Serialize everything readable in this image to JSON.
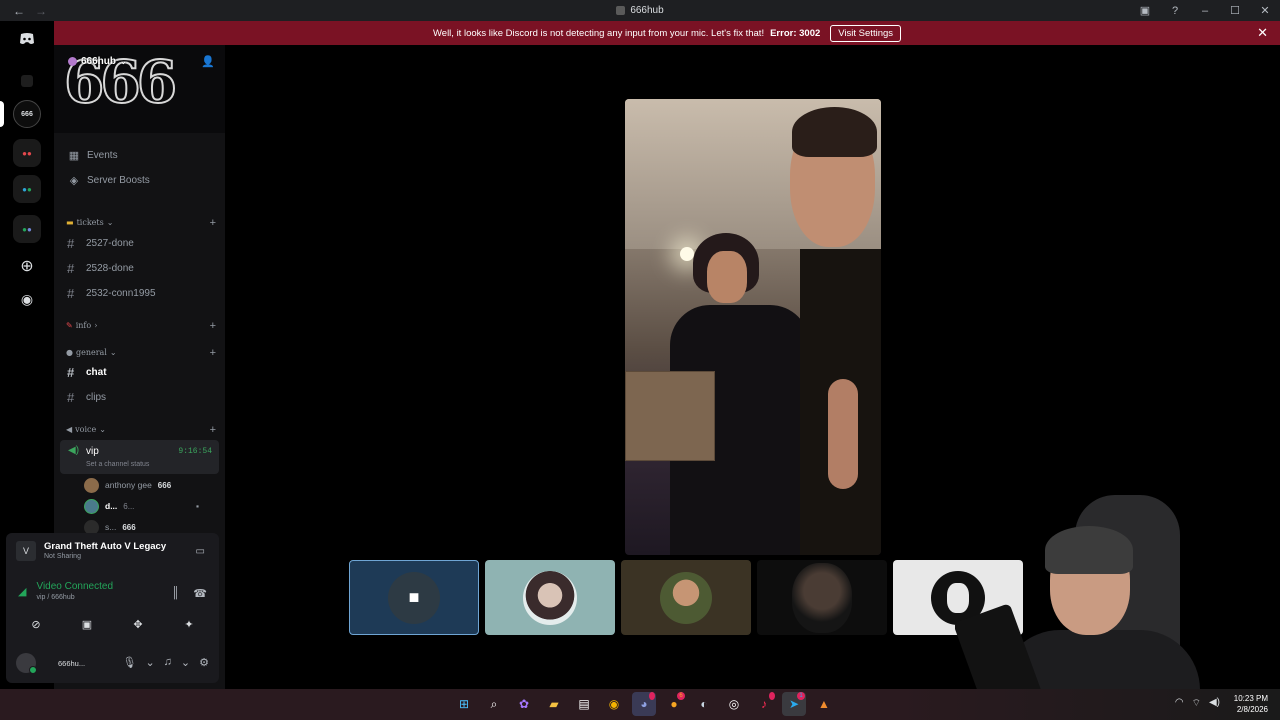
{
  "window": {
    "title": "666hub",
    "back": "←",
    "forward": "→"
  },
  "titlebar_icons": [
    "inbox-icon",
    "help-icon",
    "minimize-icon",
    "maximize-icon",
    "close-icon"
  ],
  "rail": {
    "items": [
      "discord-home-icon",
      "dm-icon",
      "server-666hub",
      "server-folder-1",
      "server-folder-2",
      "server-folder-3",
      "add-server-icon",
      "discover-icon"
    ]
  },
  "banner": {
    "message": "Well, it looks like Discord is not detecting any input from your mic. Let's fix that!",
    "error": "Error: 3002",
    "button": "Visit Settings",
    "close": "✕"
  },
  "server": {
    "name": "666hub",
    "banner_text": "666"
  },
  "sidebar": {
    "events": "Events",
    "boosts": "Server Boosts",
    "categories": {
      "tickets": "tickets",
      "info": "info",
      "general": "general",
      "voice": "voice"
    },
    "channels": {
      "c1": "2527-done",
      "c2": "2528-done",
      "c3": "2532-conn1995",
      "chat": "chat",
      "clips": "clips"
    },
    "voice_channel": {
      "name": "vip",
      "time": "9:16:54",
      "status": "Set a channel status"
    },
    "voice_users": [
      {
        "name": "anthony gee",
        "tag": "666"
      },
      {
        "name": "d...",
        "tag": "6..."
      },
      {
        "name": "s...",
        "tag": "666"
      }
    ]
  },
  "panel": {
    "game_title": "Grand Theft Auto V Legacy",
    "game_status": "Not Sharing",
    "vc_title": "Video Connected",
    "vc_sub": "vip / 666hub",
    "user_name": "666hu..."
  },
  "taskbar": {
    "time": "10:23 PM",
    "date": "2/8/2026",
    "badges": {
      "discord": "",
      "app2": "6",
      "tiktok": "",
      "telegram": "1"
    }
  },
  "colors": {
    "banner_bg": "#7a1224",
    "connected_green": "#23a55a",
    "sidebar_bg": "#121214"
  }
}
